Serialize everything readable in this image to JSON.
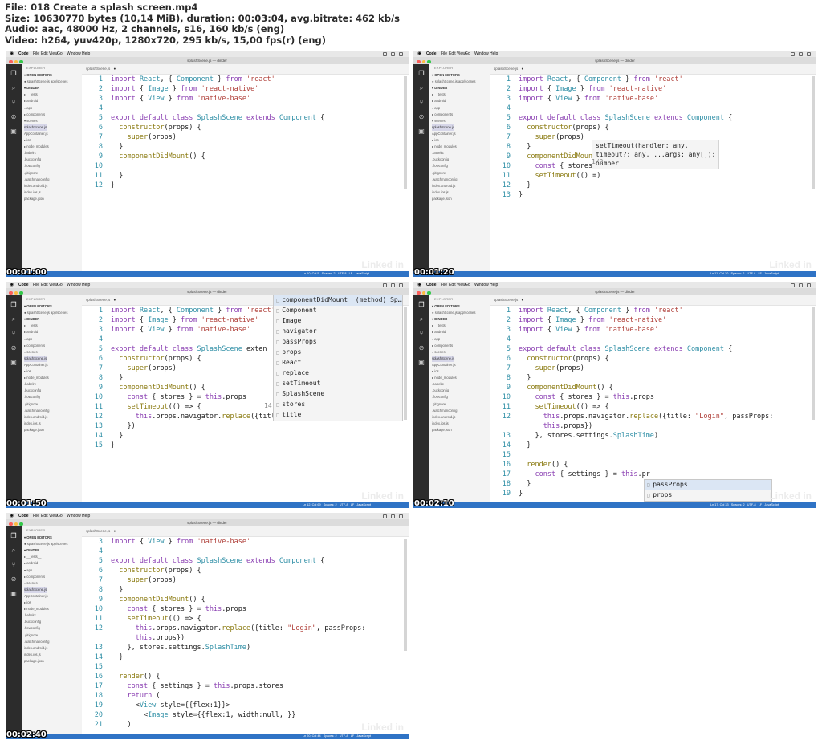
{
  "header": {
    "line1": "File: 018 Create a splash screen.mp4",
    "line2": "Size: 10630770 bytes (10,14 MiB), duration: 00:03:04, avg.bitrate: 462 kb/s",
    "line3": "Audio: aac, 48000 Hz, 2 channels, s16, 160 kb/s (eng)",
    "line4": "Video: h264, yuv420p, 1280x720, 295 kb/s, 15,00 fps(r) (eng)"
  },
  "common": {
    "menu": [
      "Code",
      "File",
      "Edit",
      "View",
      "Go",
      "Window",
      "Help"
    ],
    "window_title": "splashScene.js — dinder",
    "editor_tab": "splashScene.js",
    "explorer_title": "EXPLORER",
    "sidebar_items": [
      "▾ OPEN EDITORS",
      "  ● splashScene.js  app/scenes",
      "▾ DINDER",
      "  ▸ __tests__",
      "  ▸ android",
      "  ▾ app",
      "    ▸ components",
      "    ▾ scenes",
      "       splashScene.js",
      "       AppContainer.js",
      "  ▸ ios",
      "  ▸ node_modules",
      "    .babelrc",
      "    .buckconfig",
      "    .flowconfig",
      "    .gitignore",
      "    .watchmanconfig",
      "    index.android.js",
      "    index.ios.js",
      "    package.json"
    ],
    "watermark": "Linked in"
  },
  "thumbs": [
    {
      "timestamp": "00:01:00",
      "status": "Ln 10, Col 5   Spaces: 2   UTF-8   LF   JavaScript",
      "lines": [
        {
          "n": "1",
          "code": "import React, { Component } from 'react'"
        },
        {
          "n": "2",
          "code": "import { Image } from 'react-native'"
        },
        {
          "n": "3",
          "code": "import { View } from 'native-base'"
        },
        {
          "n": "4",
          "code": ""
        },
        {
          "n": "5",
          "code": "export default class SplashScene extends Component {"
        },
        {
          "n": "6",
          "code": "  constructor(props) {"
        },
        {
          "n": "7",
          "code": "    super(props)"
        },
        {
          "n": "8",
          "code": "  }"
        },
        {
          "n": "9",
          "code": "  componentDidMount() {"
        },
        {
          "n": "10",
          "code": ""
        },
        {
          "n": "11",
          "code": "  }"
        },
        {
          "n": "12",
          "code": "}"
        }
      ]
    },
    {
      "timestamp": "00:01:20",
      "status": "Ln 11, Col 20   Spaces: 2   UTF-8   LF   JavaScript",
      "lines": [
        {
          "n": "1",
          "code": "import React, { Component } from 'react'"
        },
        {
          "n": "2",
          "code": "import { Image } from 'react-native'"
        },
        {
          "n": "3",
          "code": "import { View } from 'native-base'"
        },
        {
          "n": "4",
          "code": ""
        },
        {
          "n": "5",
          "code": "export default class SplashScene extends Component {"
        },
        {
          "n": "6",
          "code": "  constructor(props) {"
        },
        {
          "n": "7",
          "code": "    super(props)"
        },
        {
          "n": "8",
          "code": "  }"
        },
        {
          "n": "9",
          "code": "  componentDidMount"
        },
        {
          "n": "10",
          "code": "    const { stores"
        },
        {
          "n": "11",
          "code": "    setTimeout(() =)"
        },
        {
          "n": "12",
          "code": "  }"
        },
        {
          "n": "13",
          "code": "}"
        }
      ],
      "hint": [
        "setTimeout(handler: any,",
        "timeout?: any, ...args: any[]):",
        "number"
      ],
      "hint_counter": "1/2"
    },
    {
      "timestamp": "00:01:50",
      "status": "Ln 12, Col 69   Spaces: 2   UTF-8   LF   JavaScript",
      "lines": [
        {
          "n": "1",
          "code": "import React, { Component } from 'react'"
        },
        {
          "n": "2",
          "code": "import { Image } from 'react-native'"
        },
        {
          "n": "3",
          "code": "import { View } from 'native-base'"
        },
        {
          "n": "4",
          "code": ""
        },
        {
          "n": "5",
          "code": "export default class SplashScene exten"
        },
        {
          "n": "6",
          "code": "  constructor(props) {"
        },
        {
          "n": "7",
          "code": "    super(props)"
        },
        {
          "n": "8",
          "code": "  }"
        },
        {
          "n": "9",
          "code": "  componentDidMount() {"
        },
        {
          "n": "10",
          "code": "    const { stores } = this.props"
        },
        {
          "n": "11",
          "code": "    setTimeout(() => {"
        },
        {
          "n": "12",
          "code": "      this.props.navigator.replace({title: \"Login\", passProps: this.})"
        },
        {
          "n": "13",
          "code": "    })"
        },
        {
          "n": "14",
          "code": "  }"
        },
        {
          "n": "15",
          "code": "}"
        }
      ],
      "suggest": [
        "componentDidMount  (method) Sp…",
        "Component",
        "Image",
        "navigator",
        "passProps",
        "props",
        "React",
        "replace",
        "setTimeout",
        "SplashScene",
        "stores",
        "title"
      ],
      "suggest_counter": "14"
    },
    {
      "timestamp": "00:02:10",
      "status": "Ln 17, Col 33   Spaces: 2   UTF-8   LF   JavaScript",
      "lines": [
        {
          "n": "1",
          "code": "import React, { Component } from 'react'"
        },
        {
          "n": "2",
          "code": "import { Image } from 'react-native'"
        },
        {
          "n": "3",
          "code": "import { View } from 'native-base'"
        },
        {
          "n": "4",
          "code": ""
        },
        {
          "n": "5",
          "code": "export default class SplashScene extends Component {"
        },
        {
          "n": "6",
          "code": "  constructor(props) {"
        },
        {
          "n": "7",
          "code": "    super(props)"
        },
        {
          "n": "8",
          "code": "  }"
        },
        {
          "n": "9",
          "code": "  componentDidMount() {"
        },
        {
          "n": "10",
          "code": "    const { stores } = this.props"
        },
        {
          "n": "11",
          "code": "    setTimeout(() => {"
        },
        {
          "n": "12",
          "code": "      this.props.navigator.replace({title: \"Login\", passProps:"
        },
        {
          "n": "",
          "code": "      this.props})"
        },
        {
          "n": "13",
          "code": "    }, stores.settings.SplashTime)"
        },
        {
          "n": "14",
          "code": "  }"
        },
        {
          "n": "15",
          "code": ""
        },
        {
          "n": "16",
          "code": "  render() {"
        },
        {
          "n": "17",
          "code": "    const { settings } = this.pr"
        },
        {
          "n": "18",
          "code": "  }"
        },
        {
          "n": "19",
          "code": "}"
        }
      ],
      "suggest": [
        "passProps",
        "props"
      ]
    },
    {
      "timestamp": "00:02:40",
      "status": "Ln 20, Col 44   Spaces: 2   UTF-8   LF   JavaScript",
      "lines": [
        {
          "n": "3",
          "code": "import { View } from 'native-base'"
        },
        {
          "n": "4",
          "code": ""
        },
        {
          "n": "5",
          "code": "export default class SplashScene extends Component {"
        },
        {
          "n": "6",
          "code": "  constructor(props) {"
        },
        {
          "n": "7",
          "code": "    super(props)"
        },
        {
          "n": "8",
          "code": "  }"
        },
        {
          "n": "9",
          "code": "  componentDidMount() {"
        },
        {
          "n": "10",
          "code": "    const { stores } = this.props"
        },
        {
          "n": "11",
          "code": "    setTimeout(() => {"
        },
        {
          "n": "12",
          "code": "      this.props.navigator.replace({title: \"Login\", passProps:"
        },
        {
          "n": "",
          "code": "      this.props})"
        },
        {
          "n": "13",
          "code": "    }, stores.settings.SplashTime)"
        },
        {
          "n": "14",
          "code": "  }"
        },
        {
          "n": "15",
          "code": ""
        },
        {
          "n": "16",
          "code": "  render() {"
        },
        {
          "n": "17",
          "code": "    const { settings } = this.props.stores"
        },
        {
          "n": "18",
          "code": "    return ("
        },
        {
          "n": "19",
          "code": "      <View style={{flex:1}}>"
        },
        {
          "n": "20",
          "code": "        <Image style={{flex:1, width:null, }}"
        },
        {
          "n": "21",
          "code": "    )"
        }
      ]
    }
  ]
}
